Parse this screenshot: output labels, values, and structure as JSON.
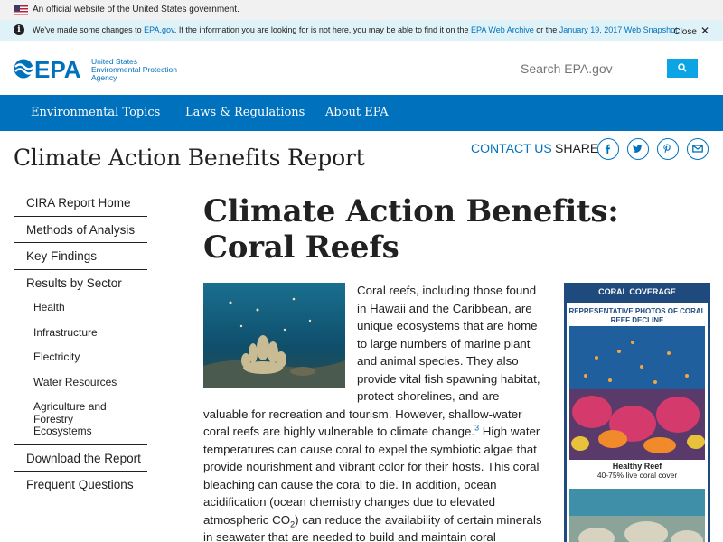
{
  "gov_banner": {
    "text": "An official website of the United States government."
  },
  "notice": {
    "prefix": "We've made some changes to ",
    "link1": "EPA.gov",
    "middle": ". If the information you are looking for is not here, you may be able to find it on the ",
    "link2": "EPA Web Archive",
    "or": " or the ",
    "link3": "January 19, 2017 Web Snapshot",
    "suffix": ".",
    "close_label": "Close"
  },
  "header": {
    "logo_text": "EPA",
    "agency_line1": "United States",
    "agency_line2": "Environmental Protection",
    "agency_line3": "Agency",
    "search_placeholder": "Search EPA.gov"
  },
  "nav": {
    "items": [
      "Environmental Topics",
      "Laws & Regulations",
      "About EPA"
    ]
  },
  "site_title": "Climate Action Benefits Report",
  "toolbar": {
    "contact": "CONTACT US",
    "share": "SHARE"
  },
  "sidebar": {
    "links": [
      "CIRA Report Home",
      "Methods of Analysis",
      "Key Findings",
      "Results by Sector"
    ],
    "sub_items": [
      "Health",
      "Infrastructure",
      "Electricity",
      "Water Resources",
      "Agriculture and Forestry",
      "Ecosystems"
    ],
    "links_after": [
      "Download the Report",
      "Frequent Questions"
    ]
  },
  "article": {
    "title": "Climate Action Benefits: Coral Reefs",
    "p1": "Coral reefs, including those found in Hawaii and the Caribbean, are unique ecosystems that are home to large numbers of marine plant and animal species. They also provide vital fish spawning habitat, protect shorelines, and are valuable for recreation and tourism. However, shallow-water coral reefs are highly vulnerable to climate change.",
    "cite": "3",
    "p2": " High water temperatures can cause coral to expel the symbiotic algae that provide nourishment and vibrant color for their hosts. This coral bleaching can cause the coral to die. In addition, ocean acidification (ocean chemistry changes due to elevated atmospheric CO",
    "sub": "2",
    "p3": ") can reduce the availability of certain minerals in seawater that are needed to build and maintain coral skeletons."
  },
  "coverage_box": {
    "header": "CORAL COVERAGE",
    "subheader": "REPRESENTATIVE PHOTOS OF CORAL REEF DECLINE",
    "caption_title": "Healthy Reef",
    "caption_detail": "40-75% live coral cover"
  },
  "colors": {
    "epa_blue": "#0071bc",
    "nav_blue": "#0071bc",
    "search_button": "#0ba5e6",
    "coverage_navy": "#1f4a7d"
  }
}
